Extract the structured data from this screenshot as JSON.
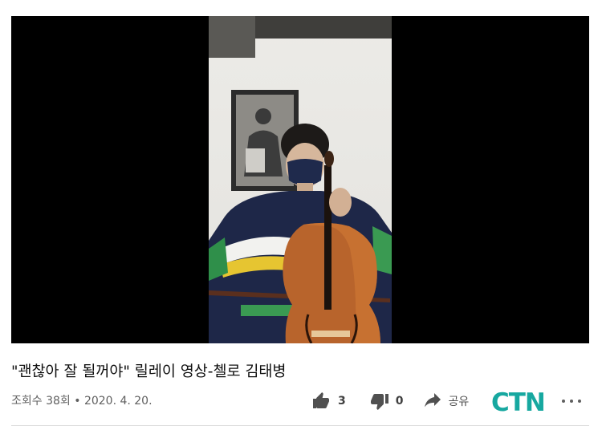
{
  "video": {
    "title": "\"괜찮아 잘 될꺼야\" 릴레이 영상-첼로 김태병",
    "meta": "조회수 38회 • 2020. 4. 20."
  },
  "actions": {
    "like_count": "3",
    "dislike_count": "0",
    "share_label": "공유"
  },
  "logo": {
    "text": "CTN"
  },
  "icons": [
    "like-icon",
    "dislike-icon",
    "share-icon",
    "more-icon"
  ]
}
